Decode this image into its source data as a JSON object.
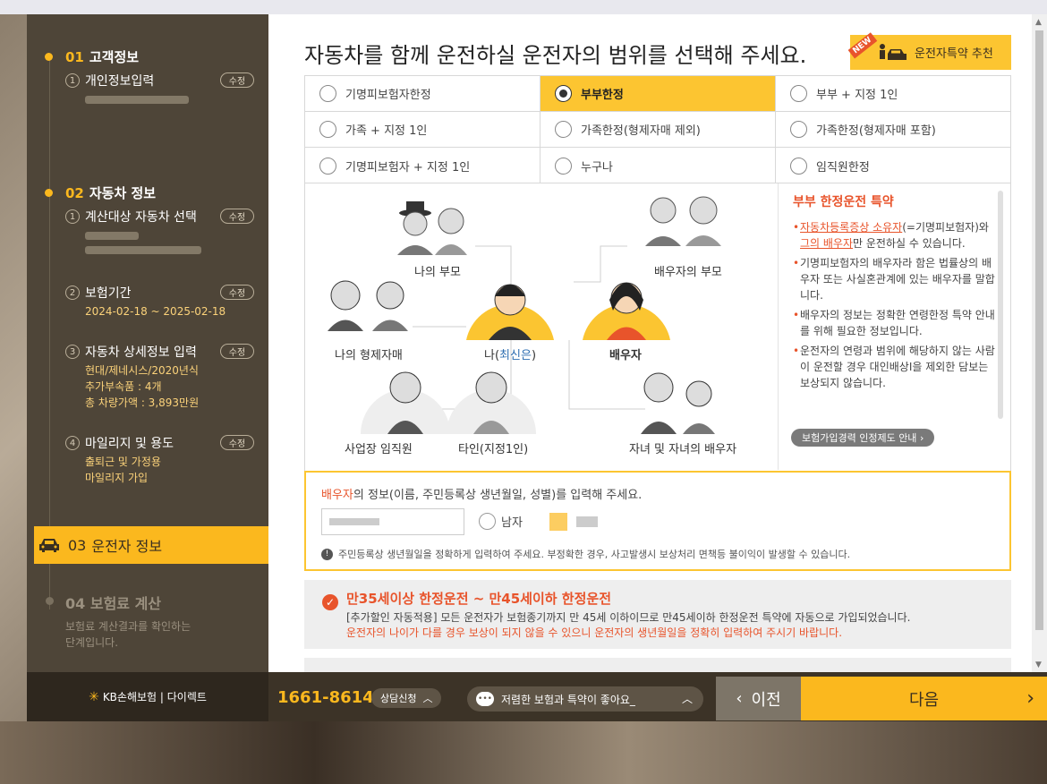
{
  "sidebar": {
    "s1": {
      "num": "01",
      "title": "고객정보",
      "sub1": {
        "idx": "1",
        "label": "개인정보입력",
        "edit": "수정"
      }
    },
    "s2": {
      "num": "02",
      "title": "자동차 정보",
      "sub1": {
        "idx": "1",
        "label": "계산대상 자동차 선택",
        "edit": "수정"
      },
      "sub2": {
        "idx": "2",
        "label": "보험기간",
        "edit": "수정",
        "value": "2024-02-18 ~ 2025-02-18"
      },
      "sub3": {
        "idx": "3",
        "label": "자동차 상세정보 입력",
        "edit": "수정",
        "v1": "현대/제네시스/2020년식",
        "v2": "추가부속품 : 4개",
        "v3": "총 차량가액 : 3,893만원"
      },
      "sub4": {
        "idx": "4",
        "label": "마일리지 및 용도",
        "edit": "수정",
        "v1": "출퇴근 및 가정용",
        "v2": "마일리지 가입"
      }
    },
    "s3": {
      "num": "03",
      "title": "운전자 정보"
    },
    "s4": {
      "num": "04",
      "title": "보험료 계산",
      "desc1": "보험료 계산결과를 확인하는",
      "desc2": "단계입니다."
    }
  },
  "main": {
    "headline": "자동차를 함께 운전하실 운전자의 범위를 선택해 주세요.",
    "recommend": {
      "badge": "NEW",
      "label": "운전자특약 추천"
    },
    "options": [
      {
        "label": "기명피보험자한정",
        "selected": false
      },
      {
        "label": "부부한정",
        "selected": true
      },
      {
        "label": "부부 + 지정 1인",
        "selected": false
      },
      {
        "label": "가족 + 지정 1인",
        "selected": false
      },
      {
        "label": "가족한정(형제자매 제외)",
        "selected": false
      },
      {
        "label": "가족한정(형제자매 포함)",
        "selected": false
      },
      {
        "label": "기명피보험자 + 지정 1인",
        "selected": false
      },
      {
        "label": "누구나",
        "selected": false
      },
      {
        "label": "임직원한정",
        "selected": false
      }
    ],
    "diagram": {
      "my_parents": "나의 부모",
      "spouse_parents": "배우자의 부모",
      "siblings": "나의 형제자매",
      "me_prefix": "나(",
      "me_name": "최신은",
      "me_suffix": ")",
      "spouse": "배우자",
      "employee": "사업장 임직원",
      "other": "타인(지정1인)",
      "children": "자녀 및 자녀의 배우자"
    },
    "info": {
      "title": "부부 한정운전 특약",
      "b1_hl1": "자동차등록증상 소유자",
      "b1_t1": "(=기명피보험자)와 ",
      "b1_hl2": "그의 배우자",
      "b1_t2": "만 운전하실 수 있습니다.",
      "b2": "기명피보험자의 배우자라 함은 법률상의 배우자 또는 사실혼관계에 있는 배우자를 말합니다.",
      "b3": "배우자의 정보는 정확한 연령한정 특약 안내를 위해 필요한 정보입니다.",
      "b4": "운전자의 연령과 범위에 해당하지 않는 사람이 운전할 경우 대인배상I을 제외한 담보는 보상되지 않습니다.",
      "button": "보험가입경력 인정제도 안내"
    },
    "spouse_form": {
      "label_hl": "배우자",
      "label_rest": "의 정보(이름, 주민등록상 생년월일, 성별)를 입력해 주세요.",
      "male": "남자",
      "warning": "주민등록상 생년월일을 정확하게 입력하여 주세요. 부정확한 경우, 사고발생시 보상처리 면책등 불이익이 발생할 수 있습니다."
    },
    "notice": {
      "title": "만35세이상 한정운전 ~ 만45세이하 한정운전",
      "line1": "[추가할인 자동적용] 모든 운전자가 보험종기까지 만 45세 이하이므로 만45세이하 한정운전 특약에 자동으로 가입되었습니다.",
      "line2": "운전자의 나이가 다를 경우 보상이 되지 않을 수 있으니 운전자의 생년월일을 정확히 입력하여 주시기 바랍니다."
    }
  },
  "bottom": {
    "logo": "KB손해보험 | 다이렉트",
    "phone": "1661-8614",
    "consult": "상담신청",
    "chat": "저렴한 보험과 특약이 좋아요_",
    "prev": "이전",
    "next": "다음"
  },
  "colors": {
    "accent": "#fbb81e",
    "highlight": "#e8542b",
    "sidebar": "#4e4538"
  }
}
